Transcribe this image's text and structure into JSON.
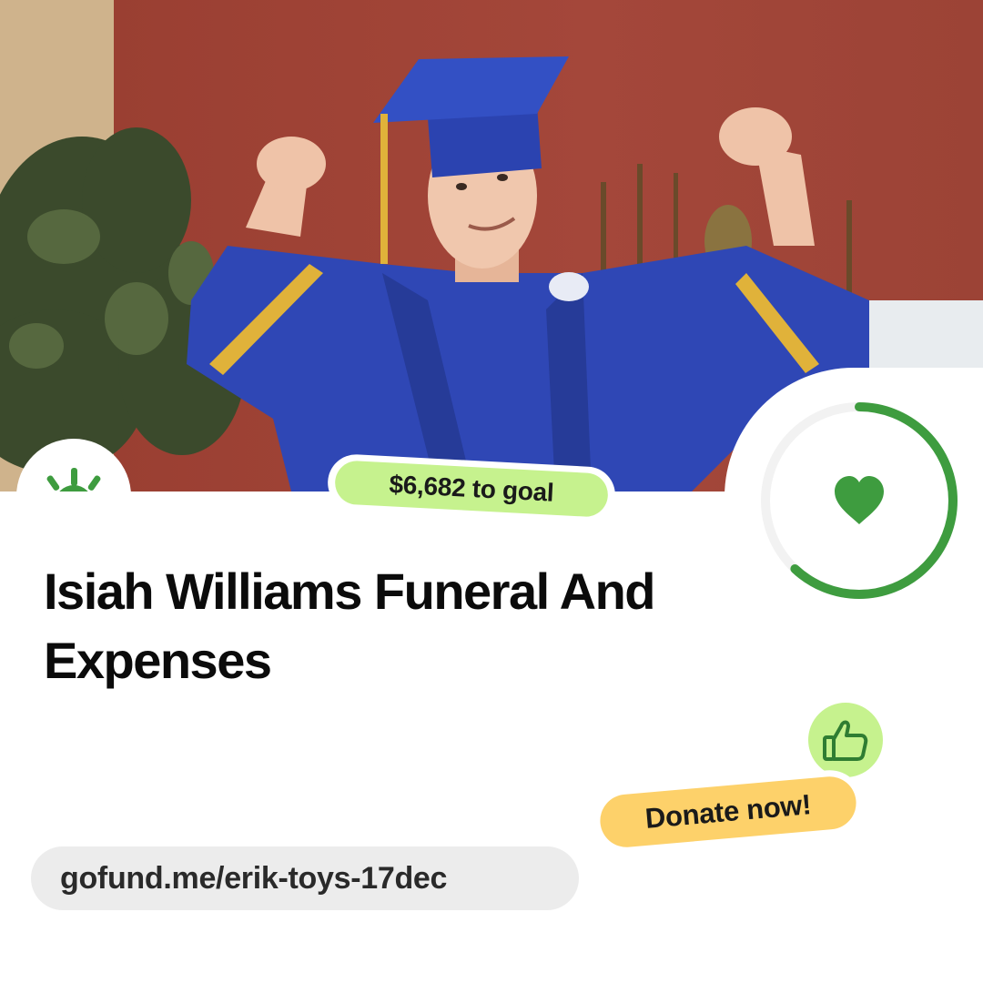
{
  "campaign": {
    "goal_text": "$6,682 to goal",
    "title": "Isiah Williams Funeral And Expenses",
    "donate_label": "Donate now!",
    "url": "gofund.me/erik-toys-17dec",
    "progress_fraction": 0.62
  },
  "icons": {
    "logo": "sunrise-logo-icon",
    "progress_center": "heart-icon",
    "donate_badge": "thumbs-up-icon"
  },
  "colors": {
    "brand_green": "#3e9c3f",
    "goal_pill": "#c6f28e",
    "donate_pill": "#fdd16a",
    "url_pill": "#ececec",
    "ring_track": "#f2f2f2"
  }
}
